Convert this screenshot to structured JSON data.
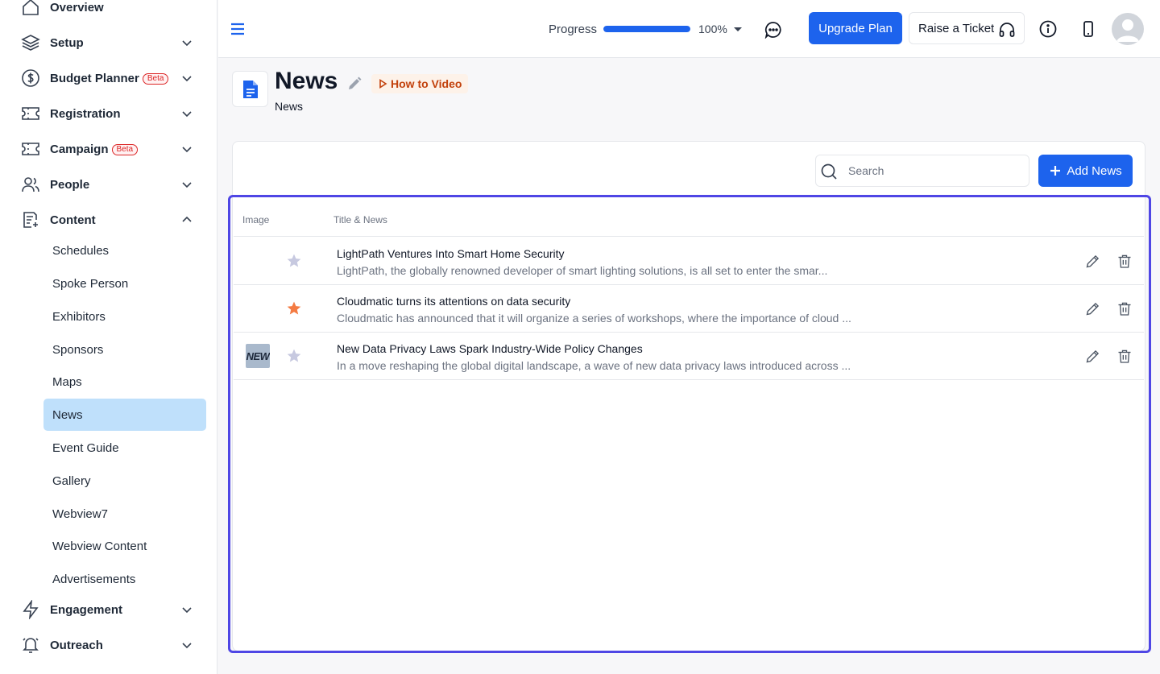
{
  "sidebar": {
    "items": [
      {
        "label": "Overview",
        "beta": ""
      },
      {
        "label": "Setup",
        "beta": ""
      },
      {
        "label": "Budget Planner",
        "beta": "Beta"
      },
      {
        "label": "Registration",
        "beta": ""
      },
      {
        "label": "Campaign",
        "beta": "Beta"
      },
      {
        "label": "People",
        "beta": ""
      },
      {
        "label": "Content",
        "beta": ""
      },
      {
        "label": "Engagement",
        "beta": ""
      },
      {
        "label": "Outreach",
        "beta": ""
      }
    ],
    "content_sub": [
      "Schedules",
      "Spoke Person",
      "Exhibitors",
      "Sponsors",
      "Maps",
      "News",
      "Event Guide",
      "Gallery",
      "Webview7",
      "Webview Content",
      "Advertisements"
    ],
    "active_sub": "News"
  },
  "header": {
    "progress_label": "Progress",
    "progress_value": 100,
    "progress_text": "100%",
    "upgrade_label": "Upgrade Plan",
    "ticket_label": "Raise a Ticket"
  },
  "page": {
    "title": "News",
    "how_to": "How to Video",
    "subtitle": "News"
  },
  "toolbar": {
    "search_placeholder": "Search",
    "add_label": "Add News"
  },
  "table": {
    "columns": [
      "Image",
      "Title & News"
    ],
    "rows": [
      {
        "thumb": "",
        "starred": false,
        "title": "LightPath Ventures Into Smart Home Security",
        "desc": "LightPath, the globally renowned developer of smart lighting solutions, is all set to enter the smar..."
      },
      {
        "thumb": "",
        "starred": true,
        "title": "Cloudmatic turns its attentions on data security",
        "desc": "Cloudmatic has announced that it will organize a series of workshops, where the importance of cloud ..."
      },
      {
        "thumb": "NEW",
        "starred": false,
        "title": "New Data Privacy Laws Spark Industry-Wide Policy Changes",
        "desc": "In a move reshaping the global digital landscape, a wave of new data privacy laws introduced across ..."
      }
    ]
  },
  "colors": {
    "primary": "#1d63ed",
    "active_sub_bg": "#bfe0fb",
    "star_on": "#f47b43",
    "star_off": "#c7c9e0",
    "frame": "#4f46e5"
  }
}
